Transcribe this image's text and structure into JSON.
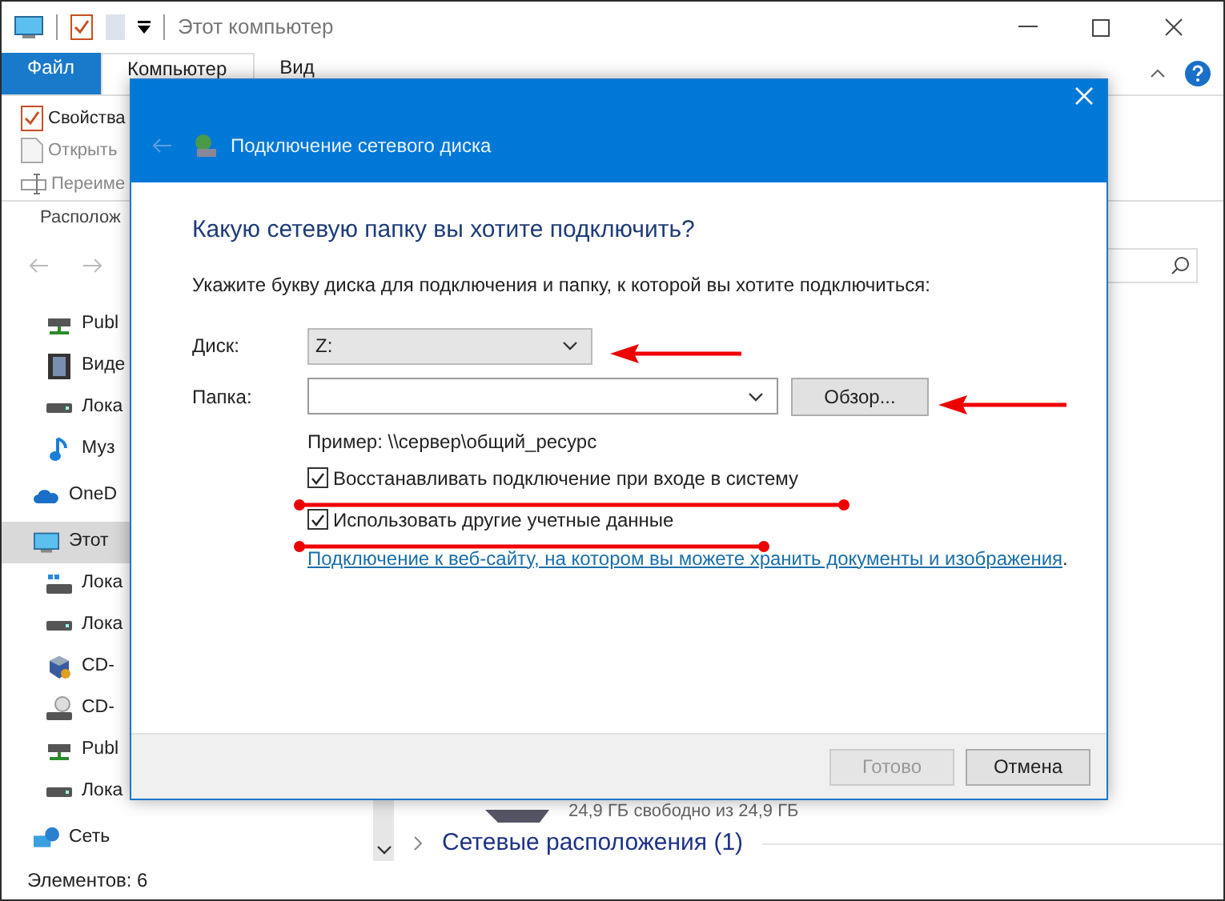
{
  "window": {
    "title": "Этот компьютер"
  },
  "ribbon": {
    "tabs": [
      {
        "label": "Файл",
        "kind": "file",
        "selected": false
      },
      {
        "label": "Компьютер",
        "kind": "tab",
        "selected": true
      },
      {
        "label": "Вид",
        "kind": "tab",
        "selected": false
      }
    ],
    "commands": [
      {
        "label": "Свойства",
        "kind": "properties",
        "disabled": false
      },
      {
        "label": "Открыть",
        "kind": "open",
        "disabled": true
      },
      {
        "label": "Переиме",
        "kind": "rename",
        "disabled": true
      }
    ],
    "group_label": "Располож"
  },
  "nav_pane": {
    "pinned": [
      {
        "label": "Publ",
        "kind": "netdrive",
        "selected": false
      },
      {
        "label": "Виде",
        "kind": "video",
        "selected": false
      },
      {
        "label": "Лока",
        "kind": "drive",
        "selected": false
      },
      {
        "label": "Муз",
        "kind": "music",
        "selected": false
      }
    ],
    "tree": [
      {
        "label": "OneD",
        "kind": "cloud",
        "selected": false
      },
      {
        "label": "Этот",
        "kind": "computer",
        "selected": true,
        "children": [
          {
            "label": "Лока",
            "kind": "windrive",
            "selected": false
          },
          {
            "label": "Лока",
            "kind": "drive",
            "selected": false
          },
          {
            "label": "CD-",
            "kind": "vbox",
            "selected": false
          },
          {
            "label": "CD-",
            "kind": "cd",
            "selected": false
          },
          {
            "label": "Publ",
            "kind": "netdrive",
            "selected": false
          },
          {
            "label": "Лока",
            "kind": "drive",
            "selected": false
          }
        ]
      },
      {
        "label": "Сеть",
        "kind": "network",
        "selected": false
      }
    ]
  },
  "content": {
    "drive_free": "24,9 ГБ свободно из 24,9 ГБ",
    "group": "Сетевые расположения (1)"
  },
  "status_bar": "Элементов: 6",
  "dialog": {
    "title": "Подключение сетевого диска",
    "heading": "Какую сетевую папку вы хотите подключить?",
    "instruction": "Укажите букву диска для подключения и папку, к которой вы хотите подключиться:",
    "fields": [
      {
        "label": "Диск:",
        "kind": "select",
        "value": "Z:"
      },
      {
        "label": "Папка:",
        "kind": "combo",
        "button": "Обзор..."
      }
    ],
    "example": "Пример: \\\\сервер\\общий_ресурс",
    "checkboxes": [
      {
        "label": "Восстанавливать подключение при входе в систему",
        "checked": true
      },
      {
        "label": "Использовать другие учетные данные",
        "checked": true
      }
    ],
    "link": "Подключение к веб-сайту, на котором вы можете хранить документы и изображения",
    "link_suffix": ".",
    "buttons": [
      {
        "label": "Готово",
        "disabled": true
      },
      {
        "label": "Отмена",
        "disabled": false
      }
    ]
  }
}
